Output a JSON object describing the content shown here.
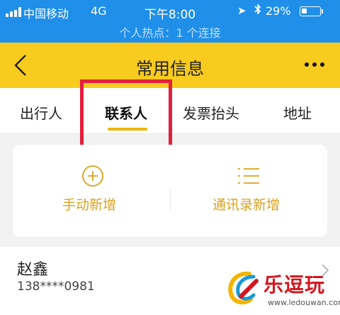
{
  "status_bar": {
    "carrier": "中国移动",
    "network": "4G",
    "time": "下午8:00",
    "battery_percent": "29%",
    "battery_level": 0.29,
    "hotspot_text": "个人热点：1 个连接",
    "icons": [
      "signal-bars",
      "location-arrow",
      "bluetooth",
      "battery"
    ]
  },
  "nav": {
    "title": "常用信息",
    "back_icon": "chevron-left",
    "more_icon": "ellipsis"
  },
  "tabs": [
    {
      "label": "出行人",
      "active": false
    },
    {
      "label": "联系人",
      "active": true
    },
    {
      "label": "发票抬头",
      "active": false
    },
    {
      "label": "地址",
      "active": false
    }
  ],
  "add_card": {
    "manual_add": {
      "label": "手动新增",
      "icon": "plus-circle"
    },
    "contacts_add": {
      "label": "通讯录新增",
      "icon": "list"
    }
  },
  "contacts": [
    {
      "name": "赵鑫",
      "phone": "138****0981"
    }
  ],
  "watermark": {
    "text": "乐逗玩",
    "url": "www.ledouwan.com"
  },
  "colors": {
    "status_bar": "#1f8fea",
    "nav_bar": "#f8cb1f",
    "accent": "#d9a21b",
    "tab_underline": "#f2b400",
    "highlight_box": "#e2203e",
    "background": "#f2f2f2"
  }
}
